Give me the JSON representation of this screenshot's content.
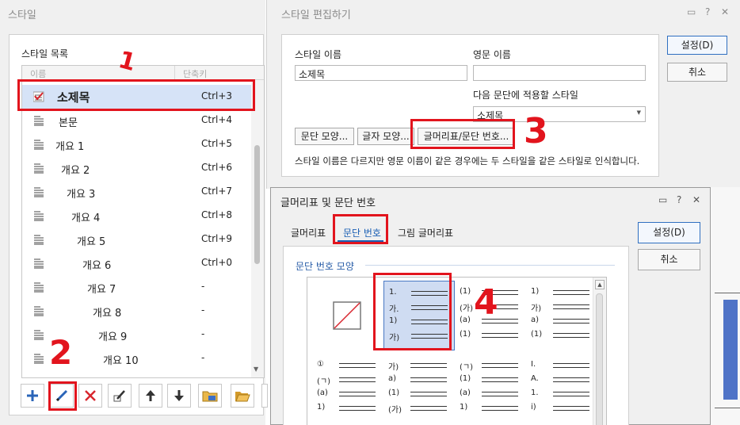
{
  "style_dialog": {
    "title": "스타일",
    "list_label": "스타일 목록",
    "columns": {
      "name": "이름",
      "shortcut": "단축키"
    },
    "styles": [
      {
        "name": "소제목",
        "shortcut": "Ctrl+3",
        "indent": 44,
        "selected": true,
        "icon": "style-checked-icon"
      },
      {
        "name": "본문",
        "shortcut": "Ctrl+4",
        "indent": 46,
        "selected": false,
        "icon": "paragraph-style-icon"
      },
      {
        "name": "개요 1",
        "shortcut": "Ctrl+5",
        "indent": 42,
        "selected": false,
        "icon": "paragraph-style-icon"
      },
      {
        "name": "개요 2",
        "shortcut": "Ctrl+6",
        "indent": 49,
        "selected": false,
        "icon": "paragraph-style-icon"
      },
      {
        "name": "개요 3",
        "shortcut": "Ctrl+7",
        "indent": 56,
        "selected": false,
        "icon": "paragraph-style-icon"
      },
      {
        "name": "개요 4",
        "shortcut": "Ctrl+8",
        "indent": 62,
        "selected": false,
        "icon": "paragraph-style-icon"
      },
      {
        "name": "개요 5",
        "shortcut": "Ctrl+9",
        "indent": 69,
        "selected": false,
        "icon": "paragraph-style-icon"
      },
      {
        "name": "개요 6",
        "shortcut": "Ctrl+0",
        "indent": 76,
        "selected": false,
        "icon": "paragraph-style-icon"
      },
      {
        "name": "개요 7",
        "shortcut": "-",
        "indent": 82,
        "selected": false,
        "icon": "paragraph-style-icon"
      },
      {
        "name": "개요 8",
        "shortcut": "-",
        "indent": 89,
        "selected": false,
        "icon": "paragraph-style-icon"
      },
      {
        "name": "개요 9",
        "shortcut": "-",
        "indent": 96,
        "selected": false,
        "icon": "paragraph-style-icon"
      },
      {
        "name": "개요 10",
        "shortcut": "-",
        "indent": 102,
        "selected": false,
        "icon": "paragraph-style-icon"
      }
    ],
    "toolbar": [
      {
        "name": "add-style-button",
        "icon": "plus-icon"
      },
      {
        "name": "edit-style-button",
        "icon": "pencil-icon"
      },
      {
        "name": "delete-style-button",
        "icon": "delete-x-icon"
      },
      {
        "name": "rename-style-button",
        "icon": "pen-edit-icon"
      },
      {
        "name": "move-up-button",
        "icon": "arrow-up-icon"
      },
      {
        "name": "move-down-button",
        "icon": "arrow-down-icon"
      },
      {
        "name": "import-style-button",
        "icon": "folder-style-icon"
      },
      {
        "name": "open-folder-button",
        "icon": "folder-open-icon"
      },
      {
        "name": "save-style-button",
        "icon": "save-icon"
      }
    ]
  },
  "edit_dialog": {
    "title": "스타일 편집하기",
    "style_name_label": "스타일 이름",
    "style_name_value": "소제목",
    "english_name_label": "영문 이름",
    "english_name_value": "",
    "next_style_label": "다음 문단에 적용할 스타일",
    "next_style_value": "소제목",
    "paragraph_shape_button": "문단 모양...",
    "char_shape_button": "글자 모양...",
    "bullet_numbering_button": "글머리표/문단 번호...",
    "note": "스타일 이름은 다르지만 영문 이름이 같은 경우에는 두 스타일을 같은 스타일로 인식합니다.",
    "ok_button": "설정(D)",
    "cancel_button": "취소"
  },
  "bn_dialog": {
    "title": "글머리표 및 문단 번호",
    "tabs": [
      "글머리표",
      "문단 번호",
      "그림 글머리표"
    ],
    "active_tab": 1,
    "section_label": "문단 번호 모양",
    "ok_button": "설정(D)",
    "cancel_button": "취소",
    "formats": [
      {
        "labels": [],
        "none": true
      },
      {
        "labels": [
          "1.",
          "가.",
          "1)",
          "가)"
        ],
        "selected": true
      },
      {
        "labels": [
          "(1)",
          "(가)",
          "(a)",
          "(1)"
        ]
      },
      {
        "labels": [
          "1)",
          "가)",
          "a)",
          "(1)"
        ]
      },
      {
        "labels": [
          "①",
          "(ㄱ)",
          "(a)",
          "1)"
        ]
      },
      {
        "labels": [
          "가)",
          "a)",
          "(1)",
          "(가)"
        ]
      },
      {
        "labels": [
          "(ㄱ)",
          "(1)",
          "(a)",
          "1)"
        ]
      },
      {
        "labels": [
          "I.",
          "A.",
          "1.",
          "i)"
        ]
      }
    ]
  },
  "annotations": [
    "1",
    "2",
    "3",
    "4"
  ],
  "colors": {
    "accent": "#1a5fb4",
    "annotation_red": "#e2141d",
    "selection": "#d6e3f7"
  }
}
